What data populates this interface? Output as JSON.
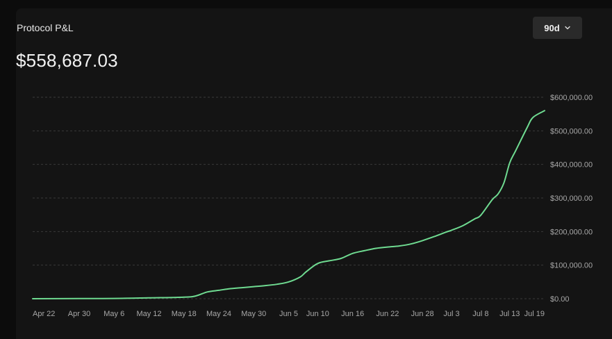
{
  "header": {
    "title": "Protocol P&L",
    "value": "$558,687.03",
    "range_label": "90d"
  },
  "colors": {
    "line": "#6fdb91",
    "grid": "#3a3a3a",
    "background": "#141414"
  },
  "chart_data": {
    "type": "line",
    "title": "Protocol P&L",
    "xlabel": "",
    "ylabel": "",
    "grid": true,
    "y_axis_position": "right",
    "ylim": [
      0,
      600000
    ],
    "y_ticks": [
      {
        "value": 0,
        "label": "$0.00"
      },
      {
        "value": 100000,
        "label": "$100,000.00"
      },
      {
        "value": 200000,
        "label": "$200,000.00"
      },
      {
        "value": 300000,
        "label": "$300,000.00"
      },
      {
        "value": 400000,
        "label": "$400,000.00"
      },
      {
        "value": 500000,
        "label": "$500,000.00"
      },
      {
        "value": 600000,
        "label": "$600,000.00"
      }
    ],
    "x_ticks": [
      "Apr 22",
      "Apr 30",
      "May 6",
      "May 12",
      "May 18",
      "May 24",
      "May 30",
      "Jun 5",
      "Jun 10",
      "Jun 16",
      "Jun 22",
      "Jun 28",
      "Jul 3",
      "Jul 8",
      "Jul 13",
      "Jul 19"
    ],
    "series": [
      {
        "values": [
          {
            "x": "Apr 22",
            "y": 0
          },
          {
            "x": "Apr 30",
            "y": 500
          },
          {
            "x": "May 6",
            "y": 800
          },
          {
            "x": "May 12",
            "y": 2500
          },
          {
            "x": "May 18",
            "y": 4500
          },
          {
            "x": "May 20",
            "y": 8000
          },
          {
            "x": "May 22",
            "y": 20000
          },
          {
            "x": "May 24",
            "y": 25000
          },
          {
            "x": "May 26",
            "y": 30000
          },
          {
            "x": "May 28",
            "y": 33000
          },
          {
            "x": "May 30",
            "y": 36000
          },
          {
            "x": "Jun 1",
            "y": 39000
          },
          {
            "x": "Jun 3",
            "y": 43000
          },
          {
            "x": "Jun 5",
            "y": 50000
          },
          {
            "x": "Jun 7",
            "y": 65000
          },
          {
            "x": "Jun 8",
            "y": 80000
          },
          {
            "x": "Jun 10",
            "y": 105000
          },
          {
            "x": "Jun 12",
            "y": 113000
          },
          {
            "x": "Jun 14",
            "y": 120000
          },
          {
            "x": "Jun 16",
            "y": 135000
          },
          {
            "x": "Jun 18",
            "y": 143000
          },
          {
            "x": "Jun 20",
            "y": 150000
          },
          {
            "x": "Jun 22",
            "y": 154000
          },
          {
            "x": "Jun 24",
            "y": 157000
          },
          {
            "x": "Jun 26",
            "y": 163000
          },
          {
            "x": "Jun 28",
            "y": 173000
          },
          {
            "x": "Jun 30",
            "y": 185000
          },
          {
            "x": "Jul 2",
            "y": 198000
          },
          {
            "x": "Jul 3",
            "y": 204000
          },
          {
            "x": "Jul 5",
            "y": 218000
          },
          {
            "x": "Jul 7",
            "y": 238000
          },
          {
            "x": "Jul 8",
            "y": 248000
          },
          {
            "x": "Jul 10",
            "y": 295000
          },
          {
            "x": "Jul 11",
            "y": 312000
          },
          {
            "x": "Jul 12",
            "y": 345000
          },
          {
            "x": "Jul 13",
            "y": 405000
          },
          {
            "x": "Jul 14",
            "y": 440000
          },
          {
            "x": "Jul 16",
            "y": 510000
          },
          {
            "x": "Jul 17",
            "y": 540000
          },
          {
            "x": "Jul 19",
            "y": 560000
          }
        ]
      }
    ]
  }
}
